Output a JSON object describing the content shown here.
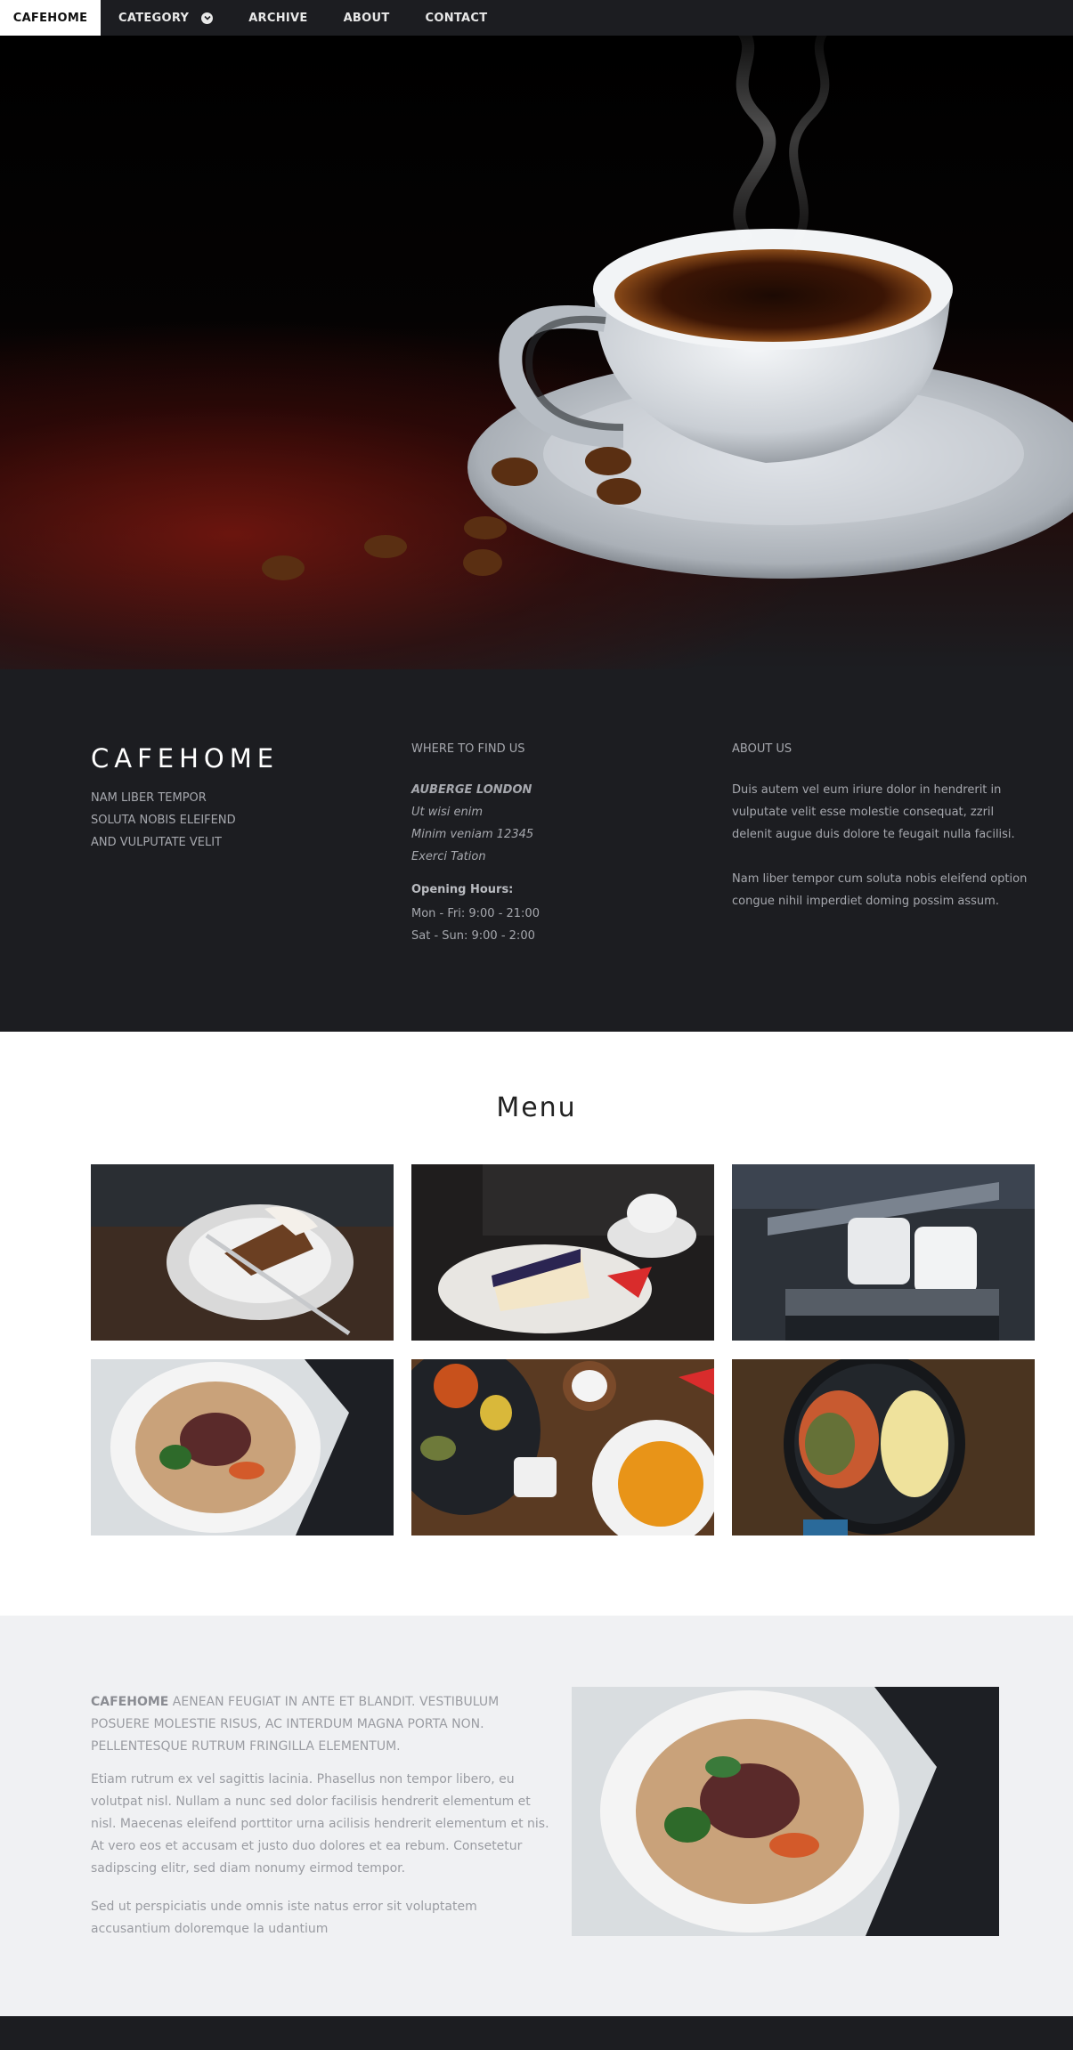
{
  "nav": {
    "brand": "CAFEHOME",
    "items": [
      "CATEGORY",
      "ARCHIVE",
      "ABOUT",
      "CONTACT"
    ]
  },
  "info": {
    "logo": "CAFEHOME",
    "tagline": [
      "NAM LIBER TEMPOR",
      "SOLUTA NOBIS ELEIFEND",
      "AND VULPUTATE VELIT"
    ],
    "find_heading": "WHERE TO FIND US",
    "address": [
      "AUBERGE LONDON",
      "Ut wisi enim",
      "Minim veniam 12345",
      "Exerci Tation"
    ],
    "hours_heading": "Opening Hours:",
    "hours": [
      "Mon - Fri: 9:00 - 21:00",
      "Sat - Sun: 9:00 - 2:00"
    ],
    "about_heading": "ABOUT US",
    "about_p1": "Duis autem vel eum iriure dolor in hendrerit in vulputate velit esse molestie consequat, zzril delenit augue duis dolore te feugait nulla facilisi.",
    "about_p2": "Nam liber tempor cum soluta nobis eleifend option congue nihil imperdiet doming possim assum."
  },
  "menu": {
    "title": "Menu"
  },
  "story": {
    "lead_brand": "CAFEHOME",
    "lead_rest": " AENEAN FEUGIAT IN ANTE ET BLANDIT. VESTIBULUM POSUERE MOLESTIE RISUS, AC INTERDUM MAGNA PORTA NON. PELLENTESQUE RUTRUM FRINGILLA ELEMENTUM.",
    "p1": "Etiam rutrum ex vel sagittis lacinia. Phasellus non tempor libero, eu volutpat nisl. Nullam a nunc sed dolor facilisis hendrerit elementum et nisl. Maecenas eleifend porttitor urna acilisis hendrerit elementum et nis. At vero eos et accusam et justo duo dolores et ea rebum. Consetetur sadipscing elitr, sed diam nonumy eirmod tempor.",
    "p2": "Sed ut perspiciatis unde omnis iste natus error sit voluptatem accusantium doloremque la udantium"
  }
}
